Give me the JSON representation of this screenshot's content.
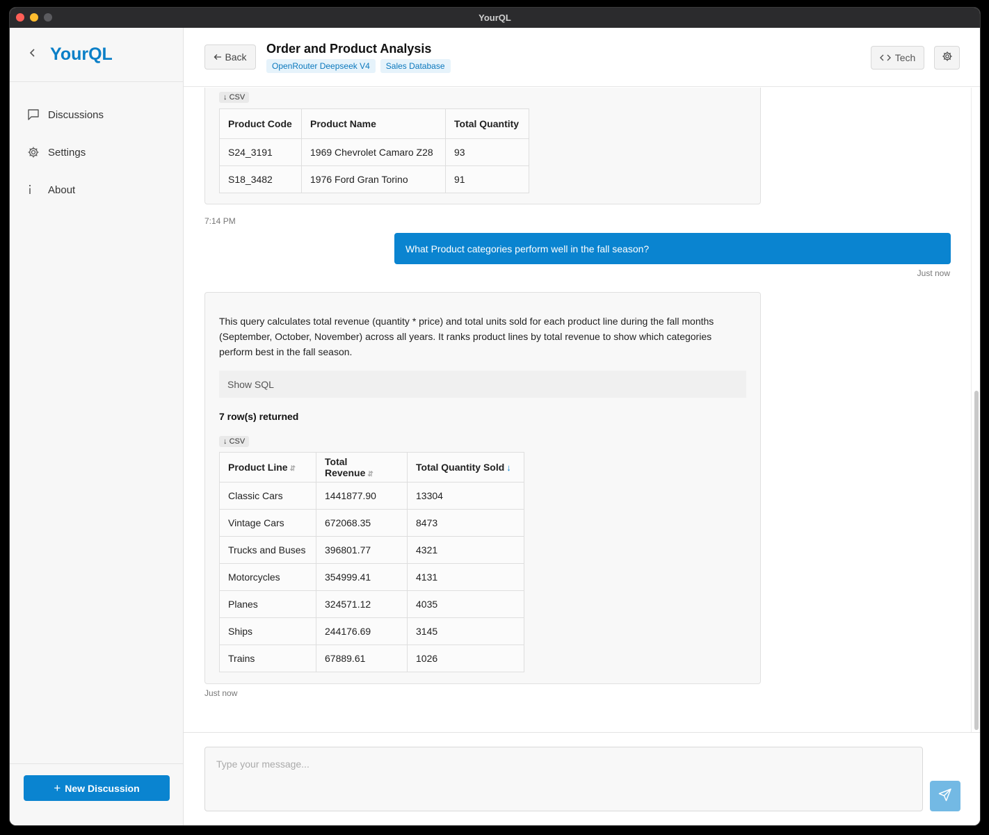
{
  "window": {
    "title": "YourQL"
  },
  "sidebar": {
    "brand": "YourQL",
    "items": [
      {
        "label": "Discussions",
        "icon": "chat-bubble-icon"
      },
      {
        "label": "Settings",
        "icon": "gear-icon"
      },
      {
        "label": "About",
        "icon": "info-icon"
      }
    ],
    "new_discussion": "New Discussion"
  },
  "header": {
    "back_label": "Back",
    "title": "Order and Product Analysis",
    "tags": [
      "OpenRouter Deepseek V4",
      "Sales Database"
    ],
    "tech_label": "Tech"
  },
  "messages": {
    "first_result": {
      "csv_label": "CSV",
      "columns": [
        "Product Code",
        "Product Name",
        "Total Quantity"
      ],
      "rows": [
        [
          "S24_3191",
          "1969 Chevrolet Camaro Z28",
          "93"
        ],
        [
          "S18_3482",
          "1976 Ford Gran Torino",
          "91"
        ]
      ],
      "time": "7:14 PM"
    },
    "user_question": {
      "text": "What Product categories perform well in the fall season?",
      "time": "Just now"
    },
    "answer": {
      "description": "This query calculates total revenue (quantity * price) and total units sold for each product line during the fall months (September, October, November) across all years. It ranks product lines by total revenue to show which categories perform best in the fall season.",
      "show_sql": "Show SQL",
      "rows_returned": "7 row(s) returned",
      "csv_label": "CSV",
      "columns": [
        "Product Line",
        "Total Revenue",
        "Total Quantity Sold"
      ],
      "rows": [
        [
          "Classic Cars",
          "1441877.90",
          "13304"
        ],
        [
          "Vintage Cars",
          "672068.35",
          "8473"
        ],
        [
          "Trucks and Buses",
          "396801.77",
          "4321"
        ],
        [
          "Motorcycles",
          "354999.41",
          "4131"
        ],
        [
          "Planes",
          "324571.12",
          "4035"
        ],
        [
          "Ships",
          "244176.69",
          "3145"
        ],
        [
          "Trains",
          "67889.61",
          "1026"
        ]
      ],
      "time": "Just now"
    }
  },
  "composer": {
    "placeholder": "Type your message..."
  },
  "colors": {
    "accent": "#0a84d0",
    "brand": "#0b7fc7"
  }
}
